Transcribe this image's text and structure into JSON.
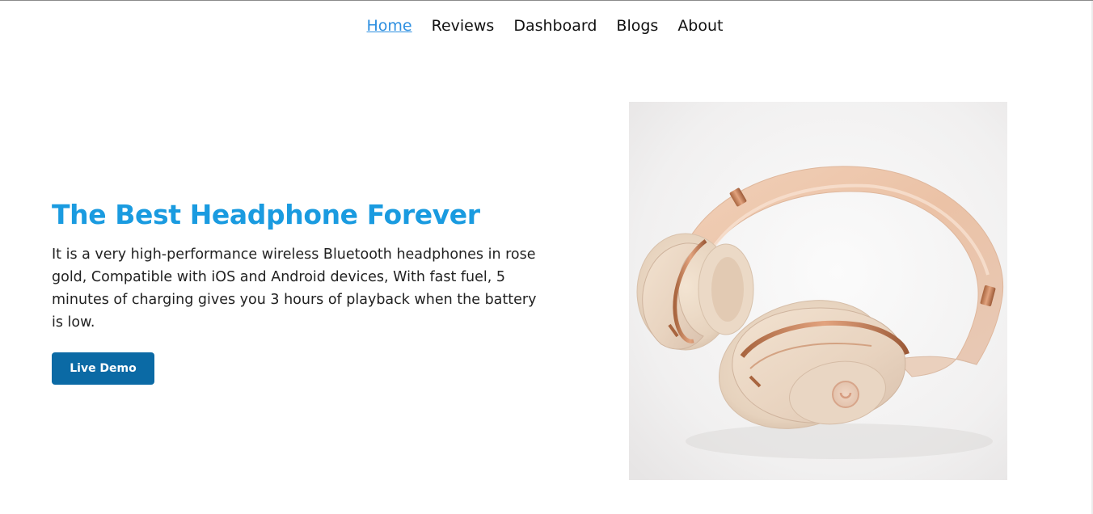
{
  "nav": {
    "items": [
      {
        "label": "Home",
        "active": true
      },
      {
        "label": "Reviews",
        "active": false
      },
      {
        "label": "Dashboard",
        "active": false
      },
      {
        "label": "Blogs",
        "active": false
      },
      {
        "label": "About",
        "active": false
      }
    ]
  },
  "hero": {
    "title": "The Best Headphone Forever",
    "description": "It is a very high-performance wireless Bluetooth headphones in rose gold, Compatible with iOS and Android devices, With fast fuel, 5 minutes of charging gives you 3 hours of playback when the battery is low.",
    "button_label": "Live Demo"
  },
  "colors": {
    "accent": "#1a9be0",
    "nav_active": "#2d8fe0",
    "button": "#0b6aa5",
    "text": "#222222"
  },
  "image": {
    "subject": "rose gold headphones"
  }
}
